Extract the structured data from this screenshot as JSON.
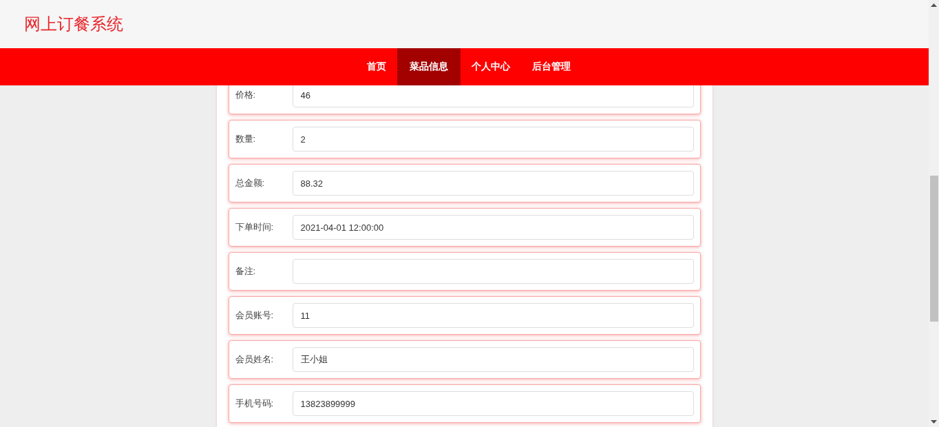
{
  "header": {
    "title": "网上订餐系统"
  },
  "nav": [
    {
      "label": "首页",
      "selected": false
    },
    {
      "label": "菜品信息",
      "selected": true
    },
    {
      "label": "个人中心",
      "selected": false
    },
    {
      "label": "后台管理",
      "selected": false
    }
  ],
  "form": [
    {
      "label": "价格:",
      "value": "46"
    },
    {
      "label": "数量:",
      "value": "2"
    },
    {
      "label": "总金额:",
      "value": "88.32"
    },
    {
      "label": "下单时间:",
      "value": "2021-04-01 12:00:00"
    },
    {
      "label": "备注:"
    },
    {
      "label": "会员账号:",
      "value": "11"
    },
    {
      "label": "会员姓名:",
      "value": "王小姐"
    },
    {
      "label": "手机号码:",
      "value": "13823899999"
    }
  ]
}
